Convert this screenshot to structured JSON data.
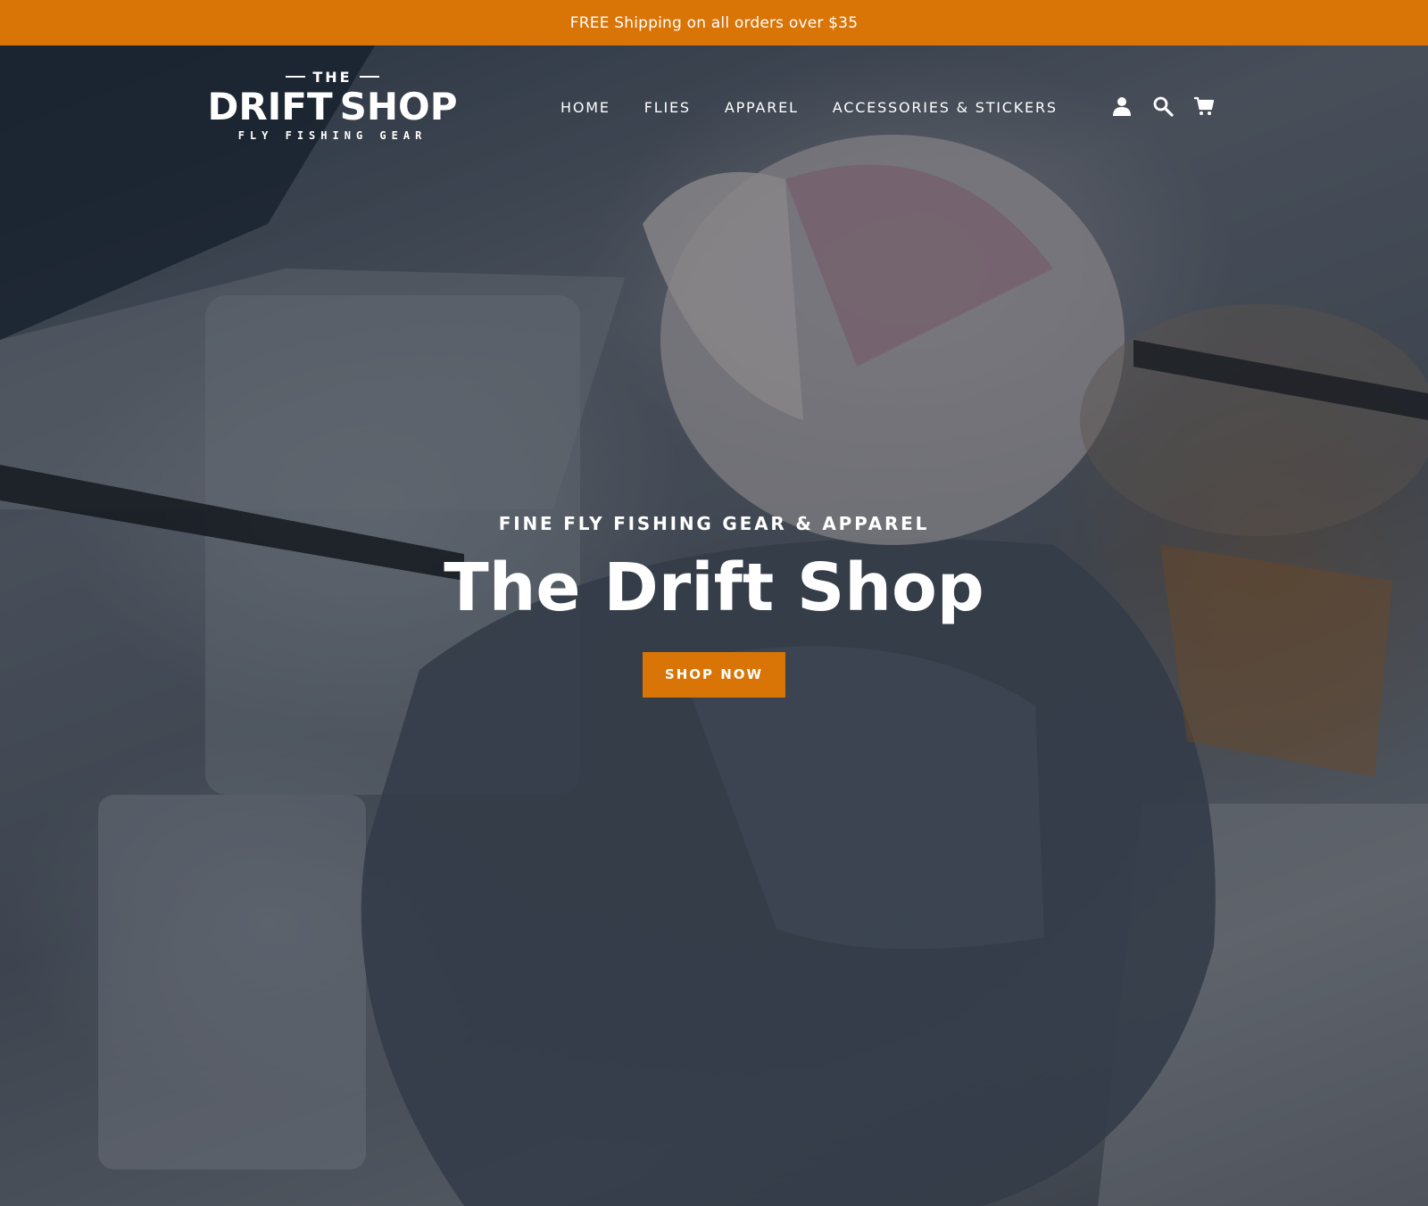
{
  "announcement": {
    "text": "FREE Shipping on all orders over $35"
  },
  "logo": {
    "top": "THE",
    "left_word": "DRIFT",
    "right_word": "SHOP",
    "sub": "FLY FISHING GEAR"
  },
  "nav": {
    "items": [
      {
        "label": "HOME"
      },
      {
        "label": "FLIES"
      },
      {
        "label": "APPAREL"
      },
      {
        "label": "ACCESSORIES & STICKERS"
      }
    ],
    "icons": [
      "account-icon",
      "search-icon",
      "cart-icon"
    ]
  },
  "hero": {
    "subtitle": "FINE FLY FISHING GEAR & APPAREL",
    "title": "The Drift Shop",
    "button_label": "SHOP NOW"
  },
  "colors": {
    "accent": "#d97406",
    "text": "#ffffff"
  }
}
